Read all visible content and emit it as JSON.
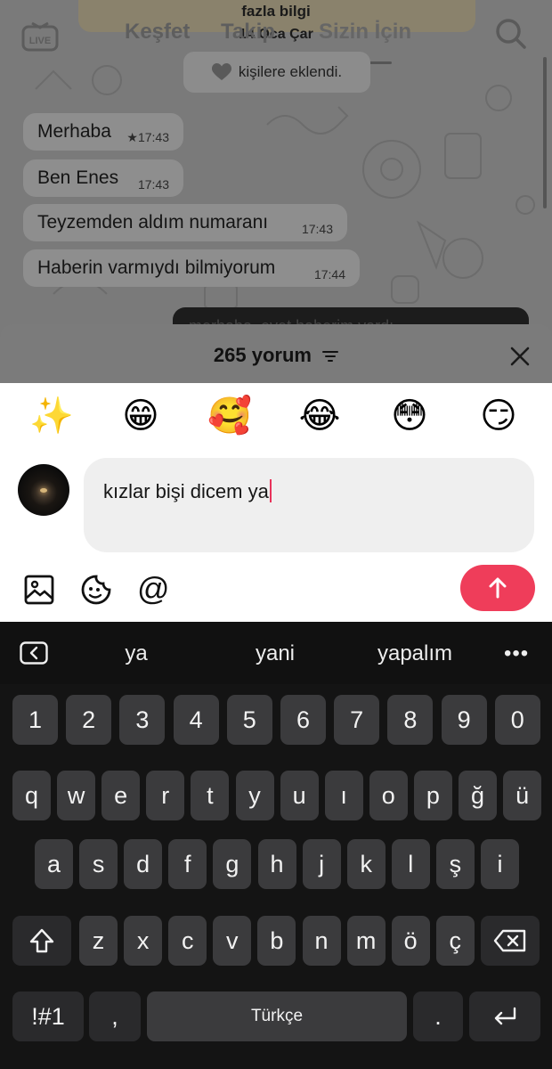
{
  "background": {
    "top_note": {
      "line1": "fazla bilgi",
      "line2": "14 Oca Çar"
    },
    "nav_tabs": [
      "Keşfet",
      "Takip",
      "Sizin İçin"
    ],
    "system_message": {
      "icon": "heart-icon",
      "text": "kişilere eklendi."
    },
    "messages": [
      {
        "text": "Merhaba",
        "time": "★17:43"
      },
      {
        "text": "Ben Enes",
        "time": "17:43"
      },
      {
        "text": "Teyzemden aldım numaranı",
        "time": "17:43"
      },
      {
        "text": "Haberin varmıydı bilmiyorum",
        "time": "17:44"
      }
    ],
    "outgoing_partial": "merhaba, evet haberim vardı"
  },
  "comments": {
    "count_label": "265 yorum",
    "emojis": [
      "✨",
      "😁",
      "🥰",
      "😂",
      "😳",
      "😏"
    ],
    "input_value": "kızlar bişi dicem ya",
    "tools": [
      "image-icon",
      "sticker-icon",
      "mention-icon"
    ],
    "mention_symbol": "@",
    "accent_color": "#ef3d5a"
  },
  "keyboard": {
    "suggestions": [
      "ya",
      "yani",
      "yapalım"
    ],
    "more": "•••",
    "row_numbers": [
      "1",
      "2",
      "3",
      "4",
      "5",
      "6",
      "7",
      "8",
      "9",
      "0"
    ],
    "row1": [
      "q",
      "w",
      "e",
      "r",
      "t",
      "y",
      "u",
      "ı",
      "o",
      "p",
      "ğ",
      "ü"
    ],
    "row2": [
      "a",
      "s",
      "d",
      "f",
      "g",
      "h",
      "j",
      "k",
      "l",
      "ş",
      "i"
    ],
    "row3": [
      "z",
      "x",
      "c",
      "v",
      "b",
      "n",
      "m",
      "ö",
      "ç"
    ],
    "symbols_label": "!#1",
    "comma": ",",
    "space_label": "Türkçe",
    "period": "."
  }
}
